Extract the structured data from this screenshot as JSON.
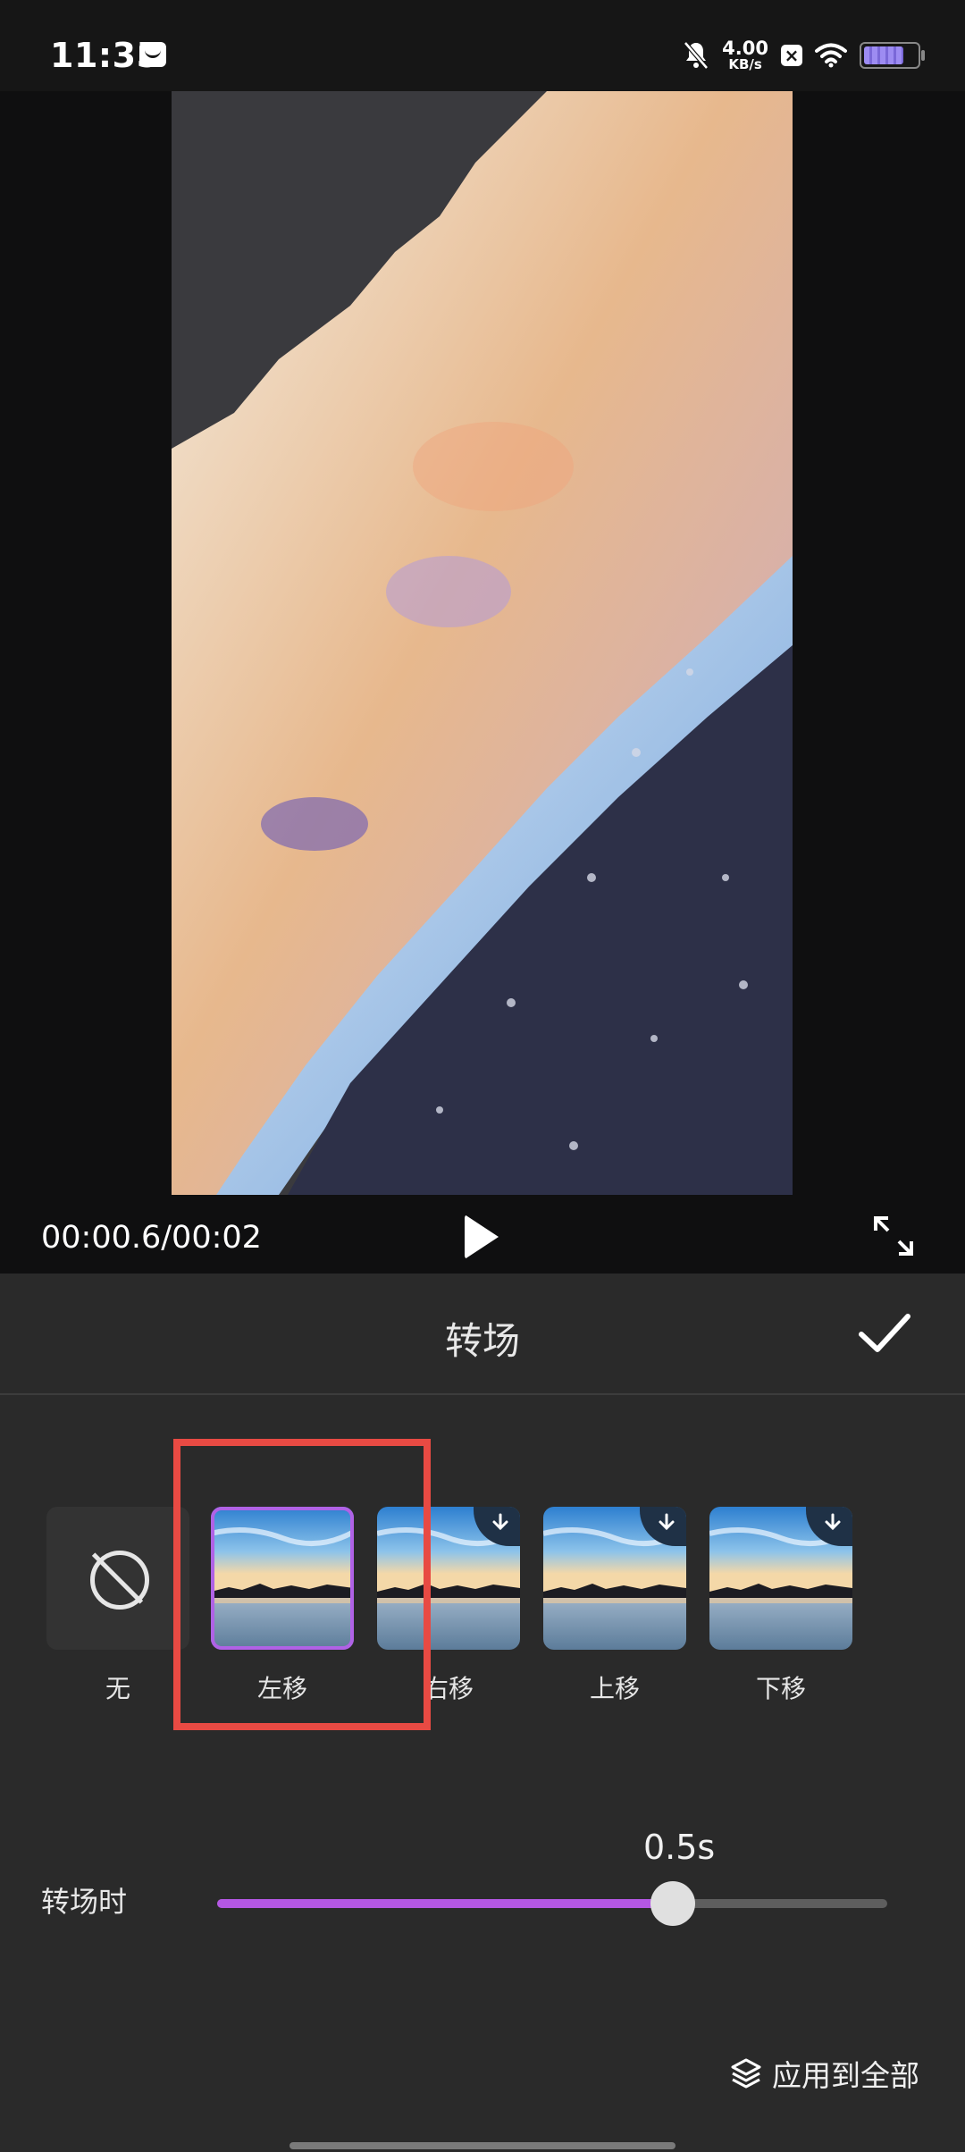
{
  "status_bar": {
    "time": "11:35",
    "net_speed_value": "4.00",
    "net_speed_unit": "KB/s",
    "battery_level": 0.75,
    "icons": [
      "message-icon",
      "mute-bell-icon",
      "x-app-icon",
      "wifi-icon",
      "battery-icon"
    ]
  },
  "player": {
    "timecode": "00:00.6/00:02",
    "icons": [
      "play-icon",
      "fullscreen-icon"
    ]
  },
  "panel": {
    "title": "转场",
    "confirm_icon": "check-icon"
  },
  "transitions": [
    {
      "label": "无",
      "type": "none",
      "selected": false,
      "download": false
    },
    {
      "label": "左移",
      "type": "preview",
      "selected": true,
      "download": false
    },
    {
      "label": "右移",
      "type": "preview",
      "selected": false,
      "download": true
    },
    {
      "label": "上移",
      "type": "preview",
      "selected": false,
      "download": true
    },
    {
      "label": "下移",
      "type": "preview",
      "selected": false,
      "download": true
    }
  ],
  "duration": {
    "label": "转场时",
    "value_text": "0.5s",
    "progress": 0.68
  },
  "apply_all": {
    "label": "应用到全部",
    "icon": "layers-icon"
  },
  "colors": {
    "accent": "#b457e3",
    "highlight_box": "#e84a43",
    "panel_bg": "#2a2a2a"
  }
}
